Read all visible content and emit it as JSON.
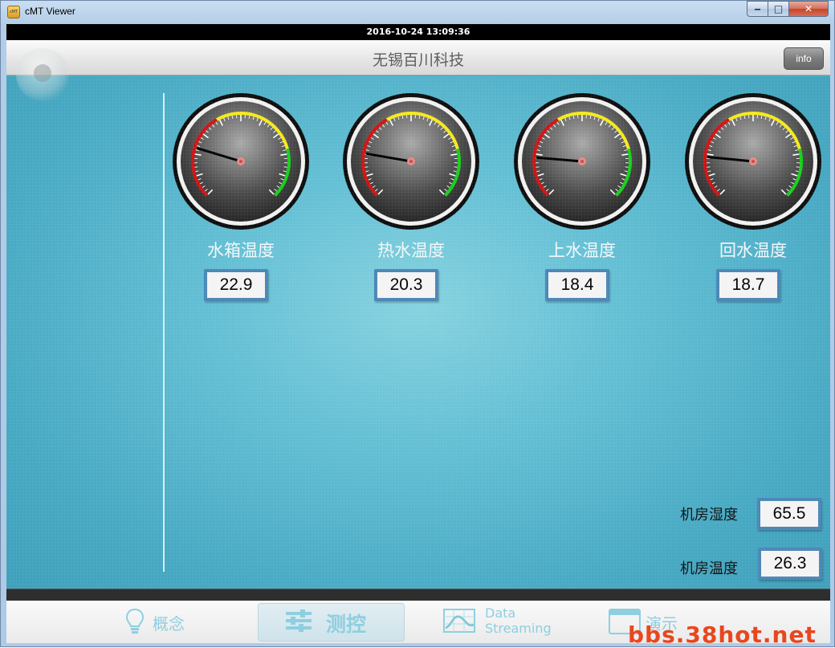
{
  "window": {
    "title": "cMT Viewer",
    "icon_text": "cMT",
    "minimize_glyph": "‒",
    "maximize_glyph": "□",
    "close_glyph": "✕"
  },
  "status": {
    "datetime": "2016-10-24 13:09:36"
  },
  "header": {
    "title": "无锡百川科技",
    "info_label": "info"
  },
  "gauges": [
    {
      "label": "水箱温度",
      "value": "22.9"
    },
    {
      "label": "热水温度",
      "value": "20.3"
    },
    {
      "label": "上水温度",
      "value": "18.4"
    },
    {
      "label": "回水温度",
      "value": "18.7"
    }
  ],
  "gauge_style": {
    "red": "#d31212",
    "yellow": "#f4ea1a",
    "green": "#17d01a",
    "needle": "#000000",
    "hub": "#e78a86"
  },
  "room": {
    "humidity": {
      "label": "机房湿度",
      "value": "65.5"
    },
    "temperature": {
      "label": "机房温度",
      "value": "26.3"
    }
  },
  "nav": {
    "items": [
      {
        "label": "概念",
        "icon": "lightbulb-icon"
      },
      {
        "label": "测控",
        "icon": "sliders-icon",
        "active": true
      },
      {
        "label_line1": "Data",
        "label_line2": "Streaming",
        "icon": "chart-icon"
      },
      {
        "label": "演示",
        "icon": "window-icon"
      }
    ]
  },
  "watermark": "bbs.38hot.net"
}
